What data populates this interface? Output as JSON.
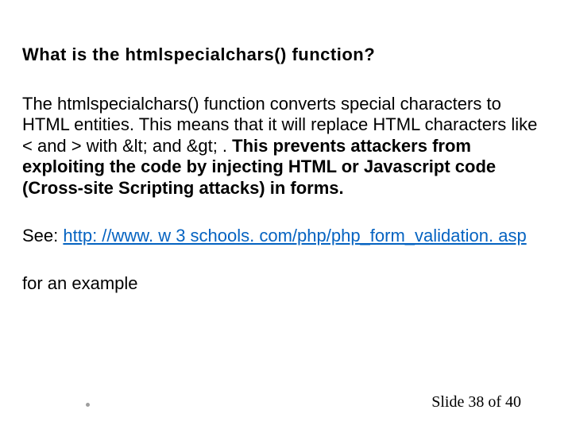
{
  "title": "What is the htmlspecialchars() function?",
  "body": {
    "plain": "The htmlspecialchars() function converts special characters to HTML entities. This means that it will replace HTML characters like < and > with &lt; and &gt; . ",
    "bold": "This prevents attackers from exploiting the code by injecting HTML or Javascript code (Cross-site Scripting attacks) in forms."
  },
  "see_prefix": "See: ",
  "see_link": "http: //www. w 3 schools. com/php/php_form_validation. asp",
  "example": "for an example",
  "footer": "Slide 38 of 40"
}
